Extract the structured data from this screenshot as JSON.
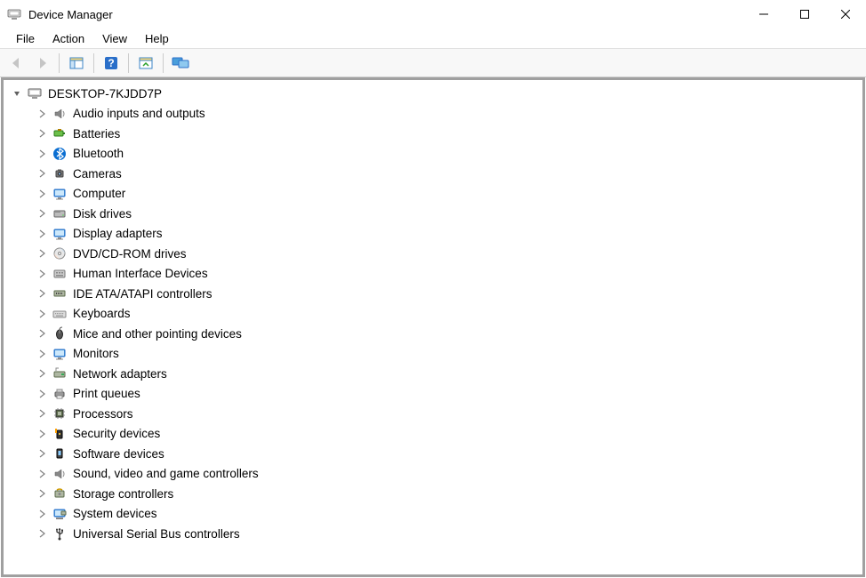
{
  "window": {
    "title": "Device Manager"
  },
  "menu": {
    "file": "File",
    "action": "Action",
    "view": "View",
    "help": "Help"
  },
  "toolbar": {
    "back": "Back",
    "forward": "Forward",
    "showhide": "Show/Hide Console Tree",
    "help": "Help",
    "properties": "Properties",
    "monitors": "View Monitors"
  },
  "tree": {
    "root": {
      "label": "DESKTOP-7KJDD7P",
      "icon": "computer-icon",
      "expanded": true
    },
    "nodes": [
      {
        "label": "Audio inputs and outputs",
        "icon": "speaker-icon"
      },
      {
        "label": "Batteries",
        "icon": "battery-icon"
      },
      {
        "label": "Bluetooth",
        "icon": "bluetooth-icon"
      },
      {
        "label": "Cameras",
        "icon": "camera-icon"
      },
      {
        "label": "Computer",
        "icon": "monitor-icon"
      },
      {
        "label": "Disk drives",
        "icon": "disk-icon"
      },
      {
        "label": "Display adapters",
        "icon": "monitor-icon"
      },
      {
        "label": "DVD/CD-ROM drives",
        "icon": "cdrom-icon"
      },
      {
        "label": "Human Interface Devices",
        "icon": "hid-icon"
      },
      {
        "label": "IDE ATA/ATAPI controllers",
        "icon": "ide-icon"
      },
      {
        "label": "Keyboards",
        "icon": "keyboard-icon"
      },
      {
        "label": "Mice and other pointing devices",
        "icon": "mouse-icon"
      },
      {
        "label": "Monitors",
        "icon": "monitor-icon"
      },
      {
        "label": "Network adapters",
        "icon": "network-icon"
      },
      {
        "label": "Print queues",
        "icon": "printer-icon"
      },
      {
        "label": "Processors",
        "icon": "cpu-icon"
      },
      {
        "label": "Security devices",
        "icon": "security-icon"
      },
      {
        "label": "Software devices",
        "icon": "software-icon"
      },
      {
        "label": "Sound, video and game controllers",
        "icon": "speaker-icon"
      },
      {
        "label": "Storage controllers",
        "icon": "storage-icon"
      },
      {
        "label": "System devices",
        "icon": "system-icon"
      },
      {
        "label": "Universal Serial Bus controllers",
        "icon": "usb-icon"
      }
    ]
  }
}
